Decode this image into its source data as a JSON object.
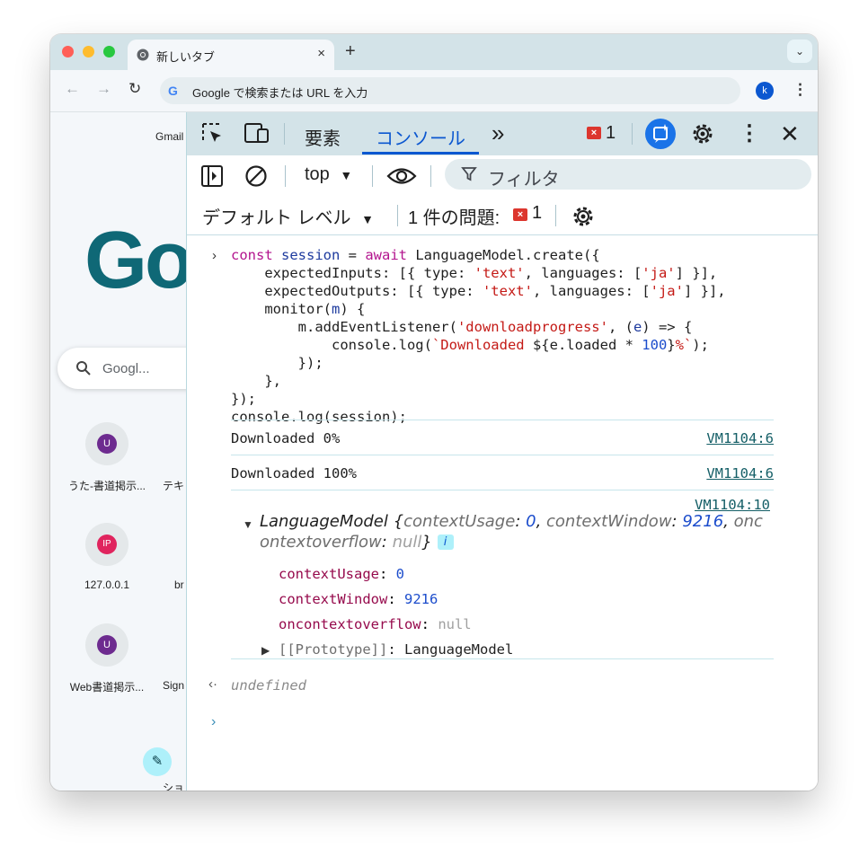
{
  "browser": {
    "tab_title": "新しいタブ",
    "tab_close": "×",
    "new_tab": "+",
    "tab_search": "⌄",
    "omnibox_placeholder": "Google で検索または URL を入力",
    "omnibox_logo": "G",
    "profile_initial": "k",
    "menu": "⋮",
    "back": "←",
    "forward": "→",
    "reload": "↻"
  },
  "ntp": {
    "gmail_link": "Gmail",
    "logo": "Go",
    "search_placeholder": "Googl...",
    "shortcuts": [
      {
        "initial": "U",
        "label": "うた-書道掲示...",
        "color": "#6d2b8f"
      },
      {
        "initial": "IP",
        "label": "127.0.0.1",
        "color": "#e0245e"
      },
      {
        "initial": "U",
        "label": "Web書道掲示...",
        "color": "#6d2b8f"
      }
    ],
    "shortcut_col2_labels": [
      "テキ",
      "br",
      "Sign"
    ],
    "edit_icon": "✎",
    "partial_label": "ショ"
  },
  "devtools": {
    "tabs": [
      "要素",
      "コンソール"
    ],
    "more_tabs": "»",
    "error_count": "1",
    "close": "✕",
    "more": "⋮",
    "context": "top",
    "filter_placeholder": "フィルタ",
    "levels": "デフォルト レベル",
    "issues_label": "1 件の問題:",
    "issues_count": "1"
  },
  "console": {
    "code_lines": [
      "const session = await LanguageModel.create({",
      "    expectedInputs: [{ type: 'text', languages: ['ja'] }],",
      "    expectedOutputs: [{ type: 'text', languages: ['ja'] }],",
      "    monitor(m) {",
      "        m.addEventListener('downloadprogress', (e) => {",
      "            console.log(`Downloaded ${e.loaded * 100}%`);",
      "        });",
      "    },",
      "});",
      "console.log(session);"
    ],
    "logs": [
      {
        "text": "Downloaded 0%",
        "source": "VM1104:6"
      },
      {
        "text": "Downloaded 100%",
        "source": "VM1104:6"
      }
    ],
    "object_source": "VM1104:10",
    "object_name": "LanguageModel",
    "object_preview": {
      "open": "{",
      "k1": "contextUsage",
      "v1": "0",
      "k2": "contextWindow",
      "v2": "9216",
      "k3_part1": "onc",
      "k3_part2": "ontextoverflow",
      "v3": "null",
      "close": "}",
      "info": "i"
    },
    "properties": [
      {
        "key": "contextUsage",
        "value": "0",
        "kind": "number"
      },
      {
        "key": "contextWindow",
        "value": "9216",
        "kind": "number"
      },
      {
        "key": "oncontextoverflow",
        "value": "null",
        "kind": "null"
      }
    ],
    "prototype_key": "[[Prototype]]",
    "prototype_value": "LanguageModel",
    "return_value": "undefined"
  }
}
